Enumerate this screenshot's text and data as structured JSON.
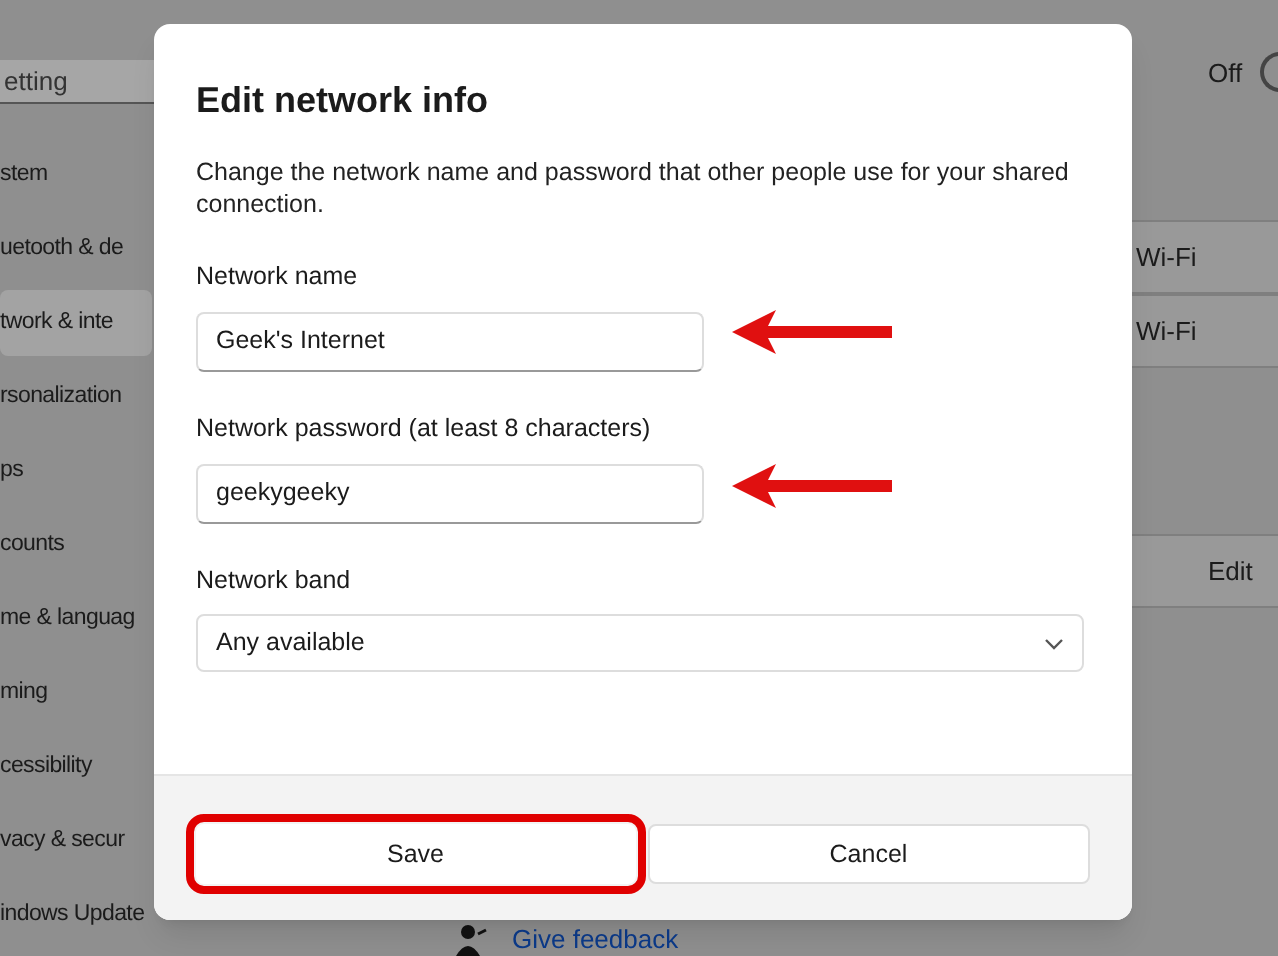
{
  "background": {
    "search": {
      "placeholder": "etting"
    },
    "sidebar": {
      "items": [
        {
          "label": "stem",
          "selected": false
        },
        {
          "label": "uetooth & de",
          "selected": false
        },
        {
          "label": "twork & inte",
          "selected": true
        },
        {
          "label": "rsonalization",
          "selected": false
        },
        {
          "label": "ps",
          "selected": false
        },
        {
          "label": "counts",
          "selected": false
        },
        {
          "label": "me & languag",
          "selected": false
        },
        {
          "label": "ming",
          "selected": false
        },
        {
          "label": "cessibility",
          "selected": false
        },
        {
          "label": "vacy & secur",
          "selected": false
        },
        {
          "label": "indows Update",
          "selected": false
        }
      ]
    },
    "status": "Off",
    "toggle": {
      "on": false
    },
    "rows": [
      "Wi-Fi",
      "Wi-Fi",
      "Edit"
    ],
    "feedback_link": "Give feedback"
  },
  "dialog": {
    "title": "Edit network info",
    "description": "Change the network name and password that other people use for your shared connection.",
    "fields": [
      {
        "label": "Network name",
        "value": "Geek's Internet",
        "arrow": true
      },
      {
        "label": "Network password (at least 8 characters)",
        "value": "geekygeeky",
        "arrow": true
      }
    ],
    "band": {
      "label": "Network band",
      "value": "Any available"
    },
    "buttons": [
      {
        "label": "Save",
        "highlighted": true
      },
      {
        "label": "Cancel",
        "highlighted": false
      }
    ]
  }
}
